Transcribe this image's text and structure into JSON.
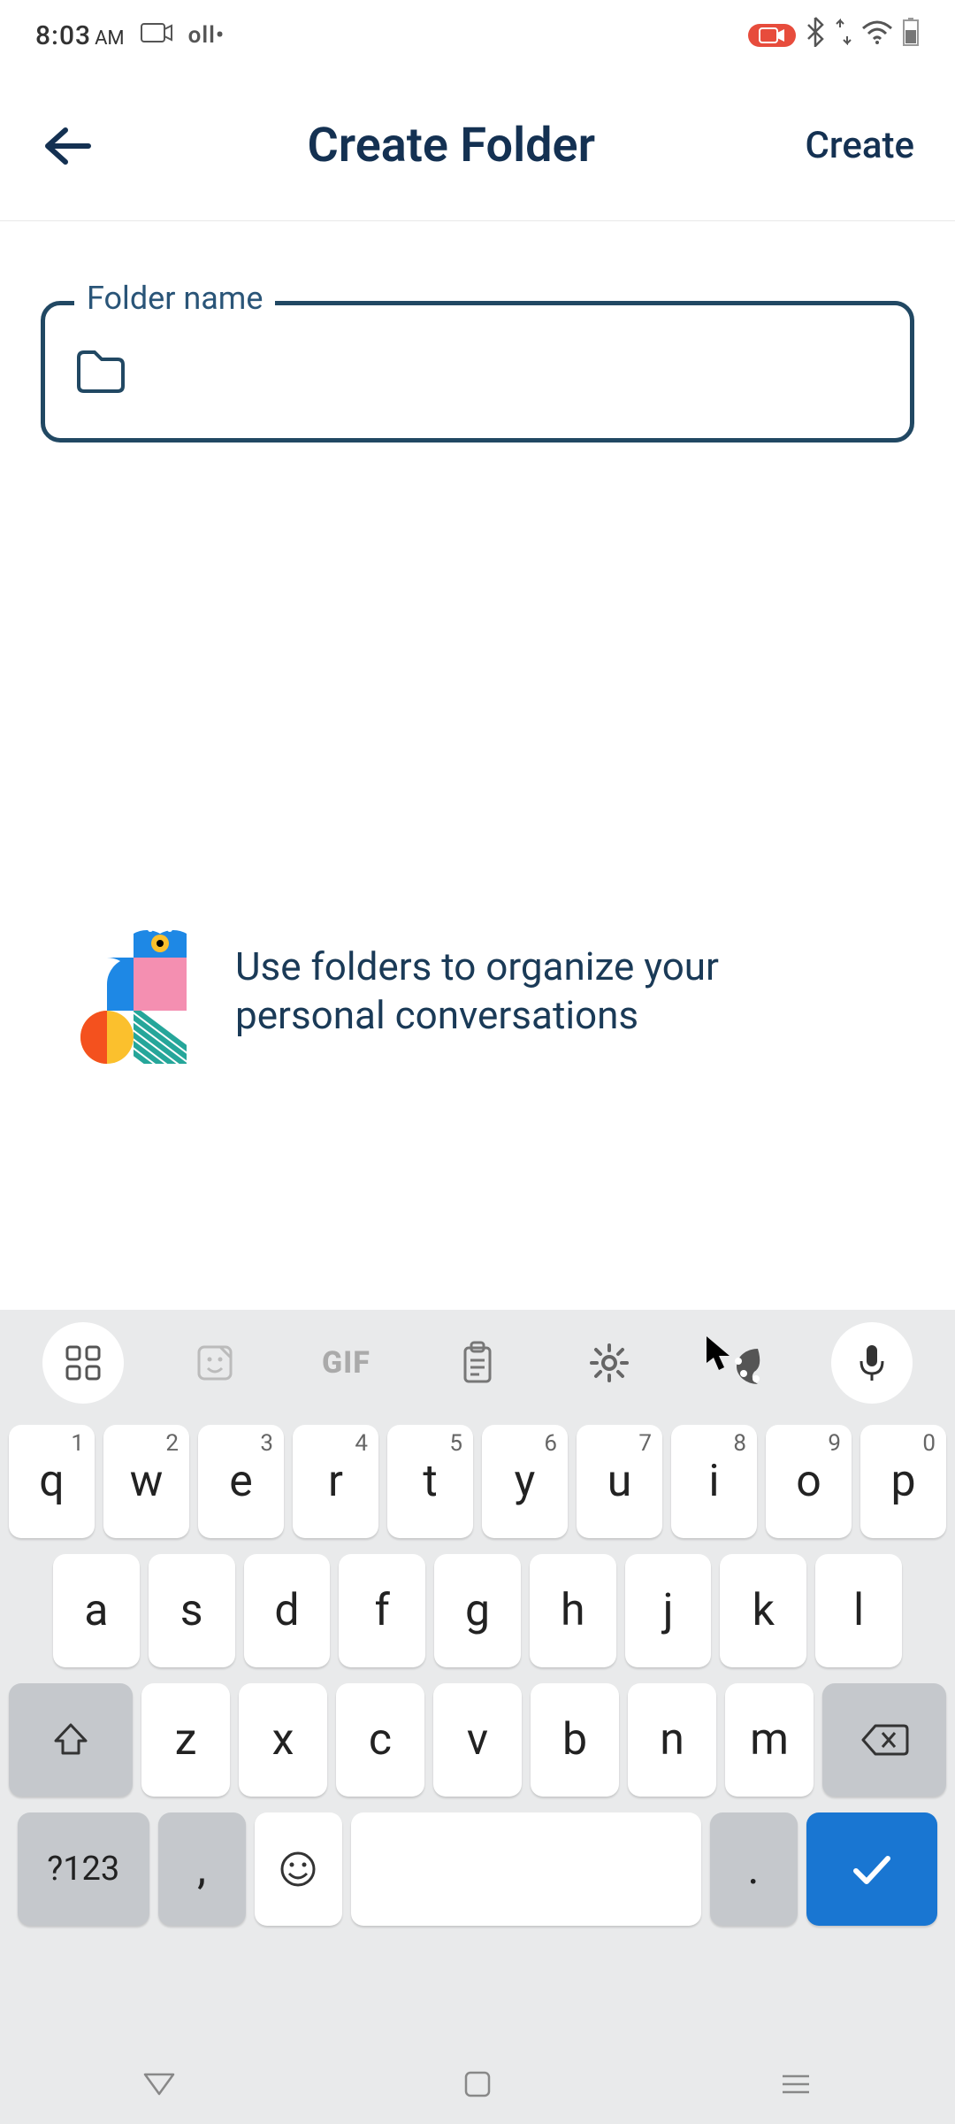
{
  "status": {
    "time_h": "8:03",
    "time_ampm": "AM",
    "camera_icon": "camera",
    "signal_text": "oll",
    "rec_icon": "rec",
    "bt_icon": "bluetooth",
    "updown_icon": "sync",
    "wifi_icon": "wifi",
    "battery_icon": "battery"
  },
  "topbar": {
    "back_label": "Back",
    "title": "Create Folder",
    "action": "Create"
  },
  "folder_field": {
    "label": "Folder name",
    "placeholder": "",
    "value": ""
  },
  "hint": {
    "text": "Use folders to organize your personal conversations"
  },
  "keyboard": {
    "toolbar": {
      "apps": "apps-icon",
      "sticker": "sticker-icon",
      "gif": "GIF",
      "clipboard": "clipboard-icon",
      "settings": "settings-icon",
      "palette": "palette-icon",
      "mic": "mic-icon"
    },
    "row1": [
      {
        "k": "q",
        "n": "1"
      },
      {
        "k": "w",
        "n": "2"
      },
      {
        "k": "e",
        "n": "3"
      },
      {
        "k": "r",
        "n": "4"
      },
      {
        "k": "t",
        "n": "5"
      },
      {
        "k": "y",
        "n": "6"
      },
      {
        "k": "u",
        "n": "7"
      },
      {
        "k": "i",
        "n": "8"
      },
      {
        "k": "o",
        "n": "9"
      },
      {
        "k": "p",
        "n": "0"
      }
    ],
    "row2": [
      {
        "k": "a"
      },
      {
        "k": "s"
      },
      {
        "k": "d"
      },
      {
        "k": "f"
      },
      {
        "k": "g"
      },
      {
        "k": "h"
      },
      {
        "k": "j"
      },
      {
        "k": "k"
      },
      {
        "k": "l"
      }
    ],
    "row3": [
      {
        "k": "z"
      },
      {
        "k": "x"
      },
      {
        "k": "c"
      },
      {
        "k": "v"
      },
      {
        "k": "b"
      },
      {
        "k": "n"
      },
      {
        "k": "m"
      }
    ],
    "bottom": {
      "switch": "?123",
      "comma": ",",
      "emoji": "emoji",
      "space": " ",
      "period": "."
    }
  },
  "navbar": {
    "back": "back-nav",
    "home": "home-nav",
    "recents": "recents-nav"
  },
  "colors": {
    "primary": "#143152",
    "field_border": "#214863",
    "hint_text": "#1a3a57"
  }
}
